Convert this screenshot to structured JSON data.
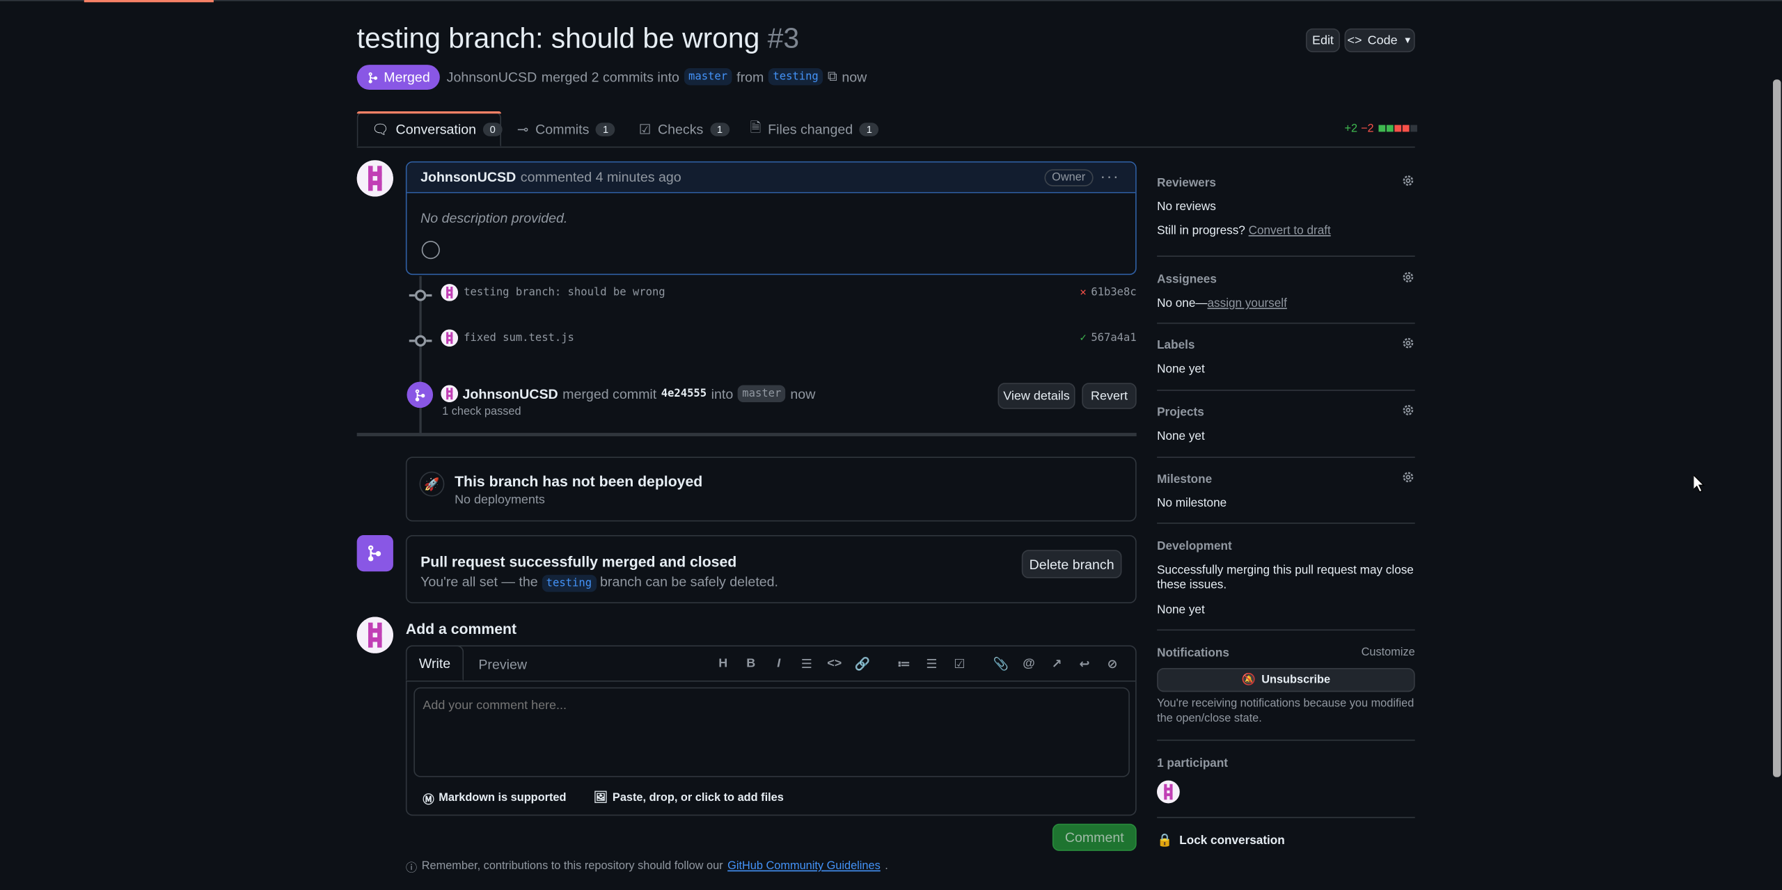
{
  "colors": {
    "accent_merged": "#8957e5",
    "link": "#4493f8",
    "success": "#3fb950",
    "danger": "#f85149",
    "background": "#0d1117"
  },
  "pr": {
    "title": "testing branch: should be wrong",
    "number": "#3",
    "status": "Merged",
    "author": "JohnsonUCSD",
    "meta_merged": "merged 2 commits into",
    "base_branch": "master",
    "meta_from": "from",
    "head_branch": "testing",
    "time": "now"
  },
  "header_buttons": {
    "edit": "Edit",
    "code": "Code"
  },
  "tabs": [
    {
      "label": "Conversation",
      "count": "0",
      "icon": "comment-discussion-icon"
    },
    {
      "label": "Commits",
      "count": "1",
      "icon": "git-commit-icon"
    },
    {
      "label": "Checks",
      "count": "1",
      "icon": "checklist-icon"
    },
    {
      "label": "Files changed",
      "count": "1",
      "icon": "file-diff-icon"
    }
  ],
  "diffstat": {
    "additions": "+2",
    "deletions": "−2"
  },
  "comment": {
    "author": "JohnsonUCSD",
    "action": "commented",
    "time": "4 minutes ago",
    "role": "Owner",
    "body": "No description provided."
  },
  "commits": [
    {
      "message": "testing branch: should be wrong",
      "sha": "61b3e8c",
      "status": "failure"
    },
    {
      "message": "fixed sum.test.js",
      "sha": "567a4a1",
      "status": "success"
    }
  ],
  "merge_event": {
    "author": "JohnsonUCSD",
    "text1": "merged commit",
    "sha": "4e24555",
    "text2": "into",
    "branch": "master",
    "time": "now",
    "checks": "1 check passed",
    "view_details": "View details",
    "revert": "Revert"
  },
  "deploy": {
    "title": "This branch has not been deployed",
    "subtitle": "No deployments"
  },
  "merged_box": {
    "title": "Pull request successfully merged and closed",
    "sub_prefix": "You're all set — the",
    "branch": "testing",
    "sub_suffix": "branch can be safely deleted.",
    "delete_button": "Delete branch"
  },
  "add_comment": {
    "title": "Add a comment",
    "write_tab": "Write",
    "preview_tab": "Preview",
    "placeholder": "Add your comment here...",
    "markdown": "Markdown is supported",
    "attach": "Paste, drop, or click to add files",
    "submit": "Comment",
    "guidelines_prefix": "Remember, contributions to this repository should follow our",
    "guidelines_link": "GitHub Community Guidelines",
    "guidelines_suffix": "."
  },
  "sidebar": {
    "reviewers": {
      "title": "Reviewers",
      "value": "No reviews",
      "progress_prefix": "Still in progress?",
      "progress_link": "Convert to draft"
    },
    "assignees": {
      "title": "Assignees",
      "value_prefix": "No one—",
      "value_link": "assign yourself"
    },
    "labels": {
      "title": "Labels",
      "value": "None yet"
    },
    "projects": {
      "title": "Projects",
      "value": "None yet"
    },
    "milestone": {
      "title": "Milestone",
      "value": "No milestone"
    },
    "development": {
      "title": "Development",
      "desc": "Successfully merging this pull request may close these issues.",
      "value": "None yet"
    },
    "notifications": {
      "title": "Notifications",
      "customize": "Customize",
      "button": "Unsubscribe",
      "desc": "You're receiving notifications because you modified the open/close state."
    },
    "participants": {
      "title": "1 participant"
    },
    "lock": "Lock conversation"
  }
}
